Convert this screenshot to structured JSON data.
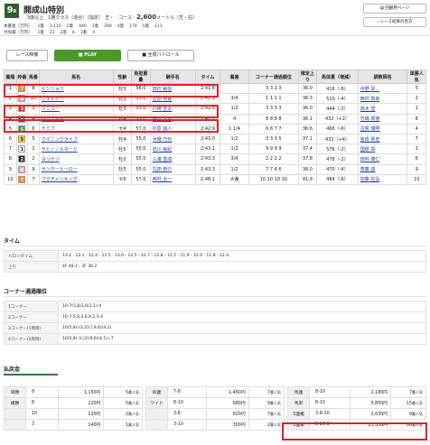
{
  "race": {
    "number": "9",
    "number_unit": "R",
    "title": "開成山特別",
    "info_prefix": "3歳以上　1勝クラス（混合）［指定］　芝・　コース：",
    "distance": "2,600",
    "info_suffix": "メートル（芝・右）"
  },
  "prize_rows": [
    {
      "label": "本賞金（万円）",
      "values": [
        "1着",
        "1,110",
        "2着",
        "440",
        "3着",
        "280",
        "4着",
        "170",
        "5着",
        "111"
      ]
    },
    {
      "label": "付加賞（万円）",
      "values": [
        "1着",
        "21",
        "2着",
        "6",
        "3着",
        "4"
      ]
    }
  ],
  "header_buttons": {
    "list": "回顧用ページ",
    "replay": "レース結果の見方"
  },
  "tabs": {
    "result": "レース映像",
    "play": "PLAY",
    "patrol": "全周パトロール"
  },
  "columns": [
    "着順",
    "枠番",
    "馬番",
    "馬名",
    "性齢",
    "負担重量",
    "騎手名",
    "タイム",
    "着差",
    "コーナー通過順位",
    "推定上り",
    "馬体重（増減）",
    "調教師名",
    "単勝人気"
  ],
  "rows": [
    {
      "pos": "1",
      "waku": "7",
      "num": "8",
      "name": "ヒシショウ",
      "sex": "牡5",
      "wt": "56.0",
      "jockey": "田辺 裕信",
      "time": "2:41.8",
      "margin": "",
      "corner": "3 3 2 3",
      "up": "36.0",
      "body": "416（-6）",
      "trainer": "中野 栄...",
      "pop": "5"
    },
    {
      "pos": "2",
      "waku": "8",
      "num": "10",
      "name": "ウェイビー",
      "sex": "牝3",
      "wt": "53.0",
      "jockey": "菅原 明良",
      "time": "2:41.9",
      "margin": "3/4",
      "corner": "1 1 1 1",
      "up": "36.3",
      "body": "510（-4）",
      "trainer": "西村 真幸",
      "pop": "2"
    },
    {
      "pos": "3",
      "waku": "3",
      "num": "3",
      "name": "リニユー",
      "sex": "牡3",
      "wt": "53.0",
      "jockey": "戸崎 圭太",
      "time": "2:42.0",
      "margin": "1/2",
      "corner": "3 3 3 3",
      "up": "36.0",
      "body": "444（-2）",
      "trainer": "高木 登",
      "pop": "1"
    },
    {
      "pos": "4",
      "waku": "4",
      "num": "4",
      "name": "ベリゾルス",
      "sex": "牡4",
      "wt": "55.0",
      "jockey": "柴田 大知",
      "time": "2:42.7",
      "margin": "4",
      "corner": "8 8 8 8",
      "up": "36.1",
      "body": "432（+2）",
      "trainer": "竹嶋 真徳",
      "pop": "8"
    },
    {
      "pos": "5",
      "waku": "6",
      "num": "6",
      "name": "ナミブ",
      "sex": "セ4",
      "wt": "57.0",
      "jockey": "杉原 誠人",
      "time": "2:42.9",
      "margin": "1 1/4",
      "corner": "6 6 7 7",
      "up": "36.6",
      "body": "466（-6）",
      "trainer": "古賀 慎明",
      "pop": "4"
    },
    {
      "pos": "6",
      "waku": "5",
      "num": "5",
      "name": "ウイニングライブ",
      "sex": "牝4",
      "wt": "55.0",
      "jockey": "木幡 巧也",
      "time": "2:43.0",
      "margin": "1/2",
      "corner": "3 3 3 5",
      "up": "37.1",
      "body": "432（+4）",
      "trainer": "金成 貴史",
      "pop": "7"
    },
    {
      "pos": "7",
      "waku": "1",
      "num": "1",
      "name": "サトノノルネード",
      "sex": "牡5",
      "wt": "55.0",
      "jockey": "石川 裕紀",
      "time": "2:43.1",
      "margin": "1/2",
      "corner": "9 9 9 9",
      "up": "37.4",
      "body": "576（-2）",
      "trainer": "国枝 栄",
      "pop": "3"
    },
    {
      "pos": "8",
      "waku": "2",
      "num": "2",
      "name": "ヨリナリ",
      "sex": "牡3",
      "wt": "55.0",
      "jockey": "三浦 皇成",
      "time": "2:43.3",
      "margin": "3/4",
      "corner": "2 2 2 2",
      "up": "37.8",
      "body": "478（-2）",
      "trainer": "田村 康仁",
      "pop": "6"
    },
    {
      "pos": "9",
      "waku": "8",
      "num": "9",
      "name": "サンデーヒーロー",
      "sex": "牡5",
      "wt": "55.0",
      "jockey": "丸田 恭介",
      "time": "2:43.3",
      "margin": "1/2",
      "corner": "7 7 6 6",
      "up": "38.0",
      "body": "470（-4）",
      "trainer": "斎藤 誠",
      "pop": "9"
    },
    {
      "pos": "10",
      "waku": "7",
      "num": "7",
      "name": "フクチャンキング",
      "sex": "セ6",
      "wt": "57.0",
      "jockey": "西村 太一",
      "time": "2:48.1",
      "margin": "大差",
      "corner": "10 10 10 10",
      "up": "41.9",
      "body": "484（-6）",
      "trainer": "加藤 征弘",
      "pop": "10"
    }
  ],
  "waku_colors": {
    "1": "#ffffff",
    "2": "#222222",
    "3": "#e0202a",
    "4": "#2a5cc4",
    "5": "#f2d21a",
    "6": "#2e9a48",
    "7": "#f08c1a",
    "8": "#f2a0c0"
  },
  "laps": {
    "title": "タイム",
    "halon_label": "ハロンタイム",
    "halon": "13.2 - 12.1 - 12.4 - 12.5 - 13.0 - 12.5 - 12.7 - 12.8 - 12.5 - 11.9 - 12.0 - 11.8 - 12.4",
    "agari_label": "上り",
    "agari": "4F 48.1 - 3F 36.2"
  },
  "corners": {
    "title": "コーナー通過順位",
    "rows": [
      {
        "label": "1コーナー",
        "text": "10-7(5,8)3,6(2,1)-4"
      },
      {
        "label": "2コーナー",
        "text": "10-7-5,8,3,6,9,2,1-4"
      },
      {
        "label": "3コーナー(1周目)",
        "text": "10(5,8)-(3,2)(7,9,6)(4,1)"
      },
      {
        "label": "4コーナー(2周目)",
        "text": "10(5,8)-3,(2)(9,6)(4,1)=7"
      }
    ]
  },
  "payout": {
    "title": "払戻金",
    "col1": [
      {
        "kind": "単勝",
        "num": "8",
        "amt": "1,150円",
        "pop": "5",
        "unit": "番人気"
      },
      {
        "kind": "複勝",
        "num": "8",
        "amt": "220円",
        "pop": "5",
        "unit": "番人気"
      },
      {
        "kind": "",
        "num": "10",
        "amt": "120円",
        "pop": "2",
        "unit": "番人気"
      },
      {
        "kind": "",
        "num": "3",
        "amt": "140円",
        "pop": "1",
        "unit": "番人気"
      }
    ],
    "col2": [
      {
        "kind": "枠連",
        "num": "7-8",
        "amt": "1,460円",
        "pop": "7",
        "unit": "番人気"
      },
      {
        "kind": "ワイド",
        "num": "8-10",
        "amt": "680円",
        "pop": "9",
        "unit": "番人気"
      },
      {
        "kind": "",
        "num": "3-8",
        "amt": "620円",
        "pop": "7",
        "unit": "番人気"
      },
      {
        "kind": "",
        "num": "3-10",
        "amt": "300円",
        "pop": "2",
        "unit": "番人気"
      }
    ],
    "col3": [
      {
        "kind": "馬連",
        "num": "8-10",
        "amt": "2,180円",
        "pop": "7",
        "unit": "番人気"
      },
      {
        "kind": "馬単",
        "num": "8-10",
        "amt": "5,850円",
        "pop": "15",
        "unit": "番人気"
      },
      {
        "kind": "3連複",
        "num": "3-8-10",
        "amt": "2,630円",
        "pop": "9",
        "unit": "番人気"
      },
      {
        "kind": "3連単",
        "num": "8-10-3",
        "amt": "23,350円",
        "pop": "88",
        "unit": "番人気"
      }
    ]
  }
}
